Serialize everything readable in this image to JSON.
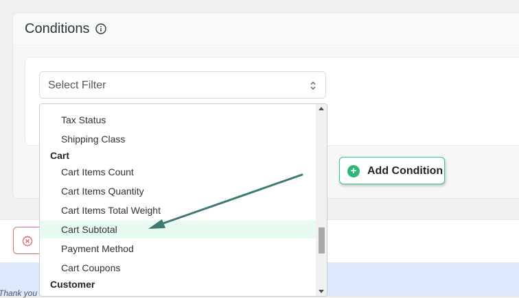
{
  "panel": {
    "title": "Conditions",
    "info_icon": "info-circle-icon"
  },
  "filter_select": {
    "value": "Select Filter",
    "chevron_icon": "chevron-updown-icon"
  },
  "dropdown": {
    "items": [
      {
        "kind": "item",
        "label": "Tax Status"
      },
      {
        "kind": "item",
        "label": "Shipping Class"
      },
      {
        "kind": "group",
        "label": "Cart"
      },
      {
        "kind": "item",
        "label": "Cart Items Count"
      },
      {
        "kind": "item",
        "label": "Cart Items Quantity"
      },
      {
        "kind": "item",
        "label": "Cart Items Total Weight"
      },
      {
        "kind": "item",
        "label": "Cart Subtotal",
        "highlighted": true
      },
      {
        "kind": "item",
        "label": "Payment Method"
      },
      {
        "kind": "item",
        "label": "Cart Coupons"
      },
      {
        "kind": "group",
        "label": "Customer"
      }
    ]
  },
  "add_condition": {
    "label": "Add Condition",
    "icon": "plus-circle-icon"
  },
  "cancel_button": {
    "icon": "x-circle-icon"
  },
  "footer": {
    "text": "Thank you"
  },
  "colors": {
    "accent_green": "#2fb875",
    "highlight": "#e7faf0",
    "danger": "#e26a6a",
    "annotation_arrow": "#3d7a73"
  }
}
